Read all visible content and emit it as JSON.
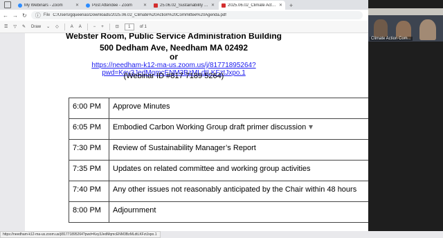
{
  "browser": {
    "tabs": [
      {
        "title": "My Webinars - Zoom",
        "favicon": "zoom-icon",
        "active": false
      },
      {
        "title": "Post Attendee - Zoom",
        "favicon": "zoom-icon",
        "active": false
      },
      {
        "title": "25.06.02_Sustainability Manager...",
        "favicon": "pdf-icon",
        "active": false
      },
      {
        "title": "2025.06.02_Climate Action Com...",
        "favicon": "pdf-icon",
        "active": true
      }
    ],
    "new_tab_label": "+",
    "address": {
      "label": "File",
      "url": "C:/Users/gqueenas/Downloads/2025.06.02_Climate%20Action%20Committee%20Agenda.pdf"
    }
  },
  "pdf_toolbar": {
    "draw_label": "Draw",
    "page_current": "1",
    "page_total": "of 1"
  },
  "document": {
    "line1": "Webster Room, Public Service Administration Building",
    "line2": "500 Dedham Ave, Needham MA 02492",
    "line3": "or",
    "link": "https://needham-k12-ma-us.zoom.us/j/81771895264?pwd=Key3JedMqmcENM3BzMLdtLKFztJxpo.1",
    "webinar_id": "(Webinar ID #817 7189 5264)",
    "agenda": [
      {
        "time": "6:00 PM",
        "item": "Approve Minutes"
      },
      {
        "time": "6:05 PM",
        "item": "Embodied Carbon Working Group draft primer discussion"
      },
      {
        "time": "7:30 PM",
        "item": "Review of Sustainability Manager’s Report"
      },
      {
        "time": "7:35 PM",
        "item": "Updates on related committee and working group activities"
      },
      {
        "time": "7:40 PM",
        "item": "Any other issues not reasonably anticipated by the Chair within 48 hours"
      },
      {
        "time": "8:00 PM",
        "item": "Adjournment"
      }
    ]
  },
  "video": {
    "tile_label": "Climate Action Com..."
  },
  "status_url": "https://needham-k12-ma-us.zoom.us/j/81771895264?pwd=Key3JedMqmcENM3BzMLdtLKFztJxpo.1"
}
